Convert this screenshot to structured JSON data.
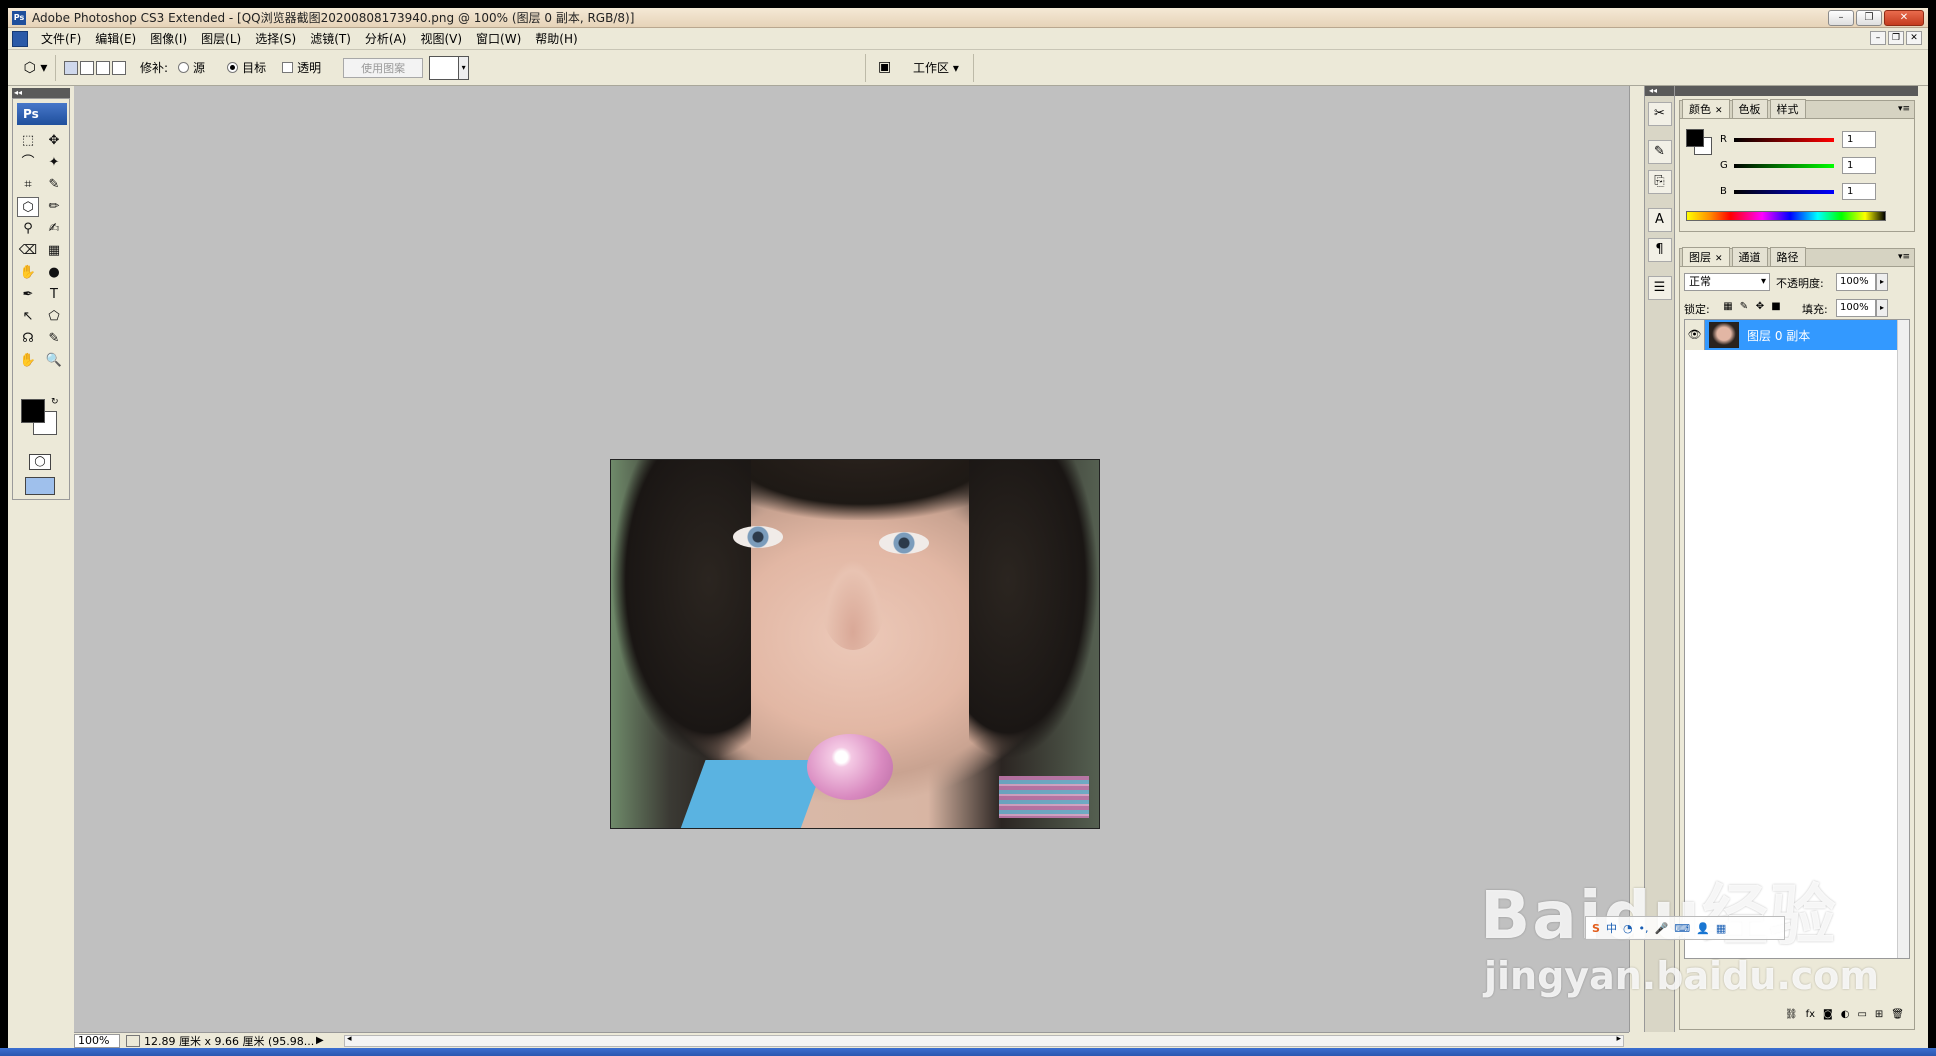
{
  "window": {
    "title": "Adobe Photoshop CS3 Extended - [QQ浏览器截图20200808173940.png @ 100% (图层 0 副本, RGB/8)]",
    "min": "–",
    "restore": "❐",
    "close": "✕"
  },
  "menu": {
    "items": [
      "文件(F)",
      "编辑(E)",
      "图像(I)",
      "图层(L)",
      "选择(S)",
      "滤镜(T)",
      "分析(A)",
      "视图(V)",
      "窗口(W)",
      "帮助(H)"
    ]
  },
  "options": {
    "patch_label": "修补:",
    "source_label": "源",
    "target_label": "目标",
    "transparent_label": "透明",
    "use_pattern": "使用图案",
    "workspace": "工作区 ▾"
  },
  "toolbox": {
    "logo": "Ps",
    "tools": [
      "⬚",
      "✥",
      "⌒",
      "✦",
      "⌗",
      "✎",
      "⬡",
      "✏",
      "⚲",
      "✍",
      "⌫",
      "▦",
      "✋",
      "●",
      "✒",
      "T",
      "↖",
      "⬠",
      "☊",
      "✎",
      "✋",
      "🔍"
    ]
  },
  "status": {
    "zoom": "100%",
    "docsize": "12.89 厘米 x 9.66 厘米 (95.98..."
  },
  "color_panel": {
    "tabs": [
      "颜色",
      "色板",
      "样式"
    ],
    "r_label": "R",
    "g_label": "G",
    "b_label": "B",
    "r_value": "1",
    "g_value": "1",
    "b_value": "1"
  },
  "layers_panel": {
    "tabs": [
      "图层",
      "通道",
      "路径"
    ],
    "blend_mode": "正常",
    "opacity_label": "不透明度:",
    "opacity": "100%",
    "lock_label": "锁定:",
    "fill_label": "填充:",
    "fill": "100%",
    "layer_name": "图层 0 副本"
  },
  "watermark": {
    "brand": "Baidu经验",
    "url": "jingyan.baidu.com"
  },
  "colors": {
    "layer_selected": "#3399ff",
    "canvas_bg": "#c0c0c0"
  }
}
